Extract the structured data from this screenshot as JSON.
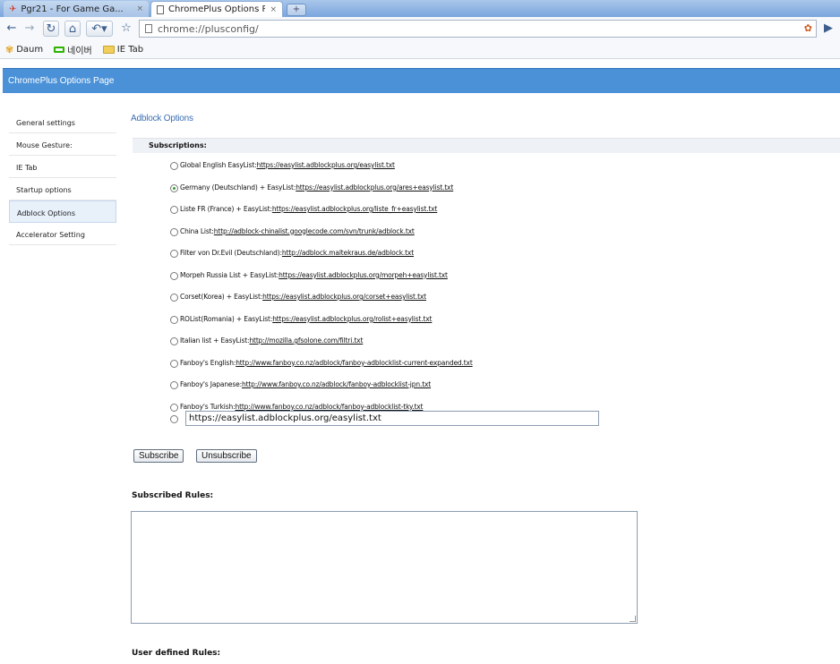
{
  "browser": {
    "tabs": [
      {
        "title": "Pgr21 - For Game Ga...",
        "active": false,
        "icon": "bird-favicon-icon"
      },
      {
        "title": "ChromePlus Options P...",
        "active": true,
        "icon": "page-favicon-icon"
      }
    ],
    "new_tab": "+",
    "tab_close": "×",
    "url": "chrome://plusconfig/",
    "bookmarks": [
      {
        "label": "Daum",
        "icon": "daum-icon"
      },
      {
        "label": "네이버",
        "icon": "naver-icon"
      },
      {
        "label": "IE Tab",
        "icon": "folder-icon"
      }
    ]
  },
  "header": {
    "title": "ChromePlus Options Page"
  },
  "sidebar": {
    "items": [
      {
        "label": "General settings",
        "selected": false
      },
      {
        "label": "Mouse Gesture:",
        "selected": false
      },
      {
        "label": "IE Tab",
        "selected": false
      },
      {
        "label": "Startup options",
        "selected": false
      },
      {
        "label": "Adblock Options",
        "selected": true
      },
      {
        "label": "Accelerator Setting",
        "selected": false
      }
    ]
  },
  "main": {
    "section_title": "Adblock Options",
    "subscriptions_label": "Subscriptions:",
    "subscriptions": [
      {
        "name": "Global English EasyList:",
        "url": "https://easylist.adblockplus.org/easylist.txt",
        "checked": false
      },
      {
        "name": "Germany (Deutschland) + EasyList:",
        "url": "https://easylist.adblockplus.org/ares+easylist.txt",
        "checked": true
      },
      {
        "name": "Liste FR (France) + EasyList:",
        "url": "https://easylist.adblockplus.org/liste_fr+easylist.txt",
        "checked": false
      },
      {
        "name": "China List:",
        "url": "http://adblock-chinalist.googlecode.com/svn/trunk/adblock.txt",
        "checked": false
      },
      {
        "name": "Filter von Dr.Evil (Deutschland):",
        "url": "http://adblock.maltekraus.de/adblock.txt",
        "checked": false
      },
      {
        "name": "Morpeh Russia List + EasyList:",
        "url": "https://easylist.adblockplus.org/morpeh+easylist.txt",
        "checked": false
      },
      {
        "name": "Corset(Korea) + EasyList: ",
        "url": "https://easylist.adblockplus.org/corset+easylist.txt",
        "checked": false
      },
      {
        "name": "ROList(Romania) + EasyList: ",
        "url": "https://easylist.adblockplus.org/rolist+easylist.txt",
        "checked": false
      },
      {
        "name": "Italian list + EasyList: ",
        "url": "http://mozilla.gfsolone.com/filtri.txt",
        "checked": false
      },
      {
        "name": "Fanboy's English: ",
        "url": "http://www.fanboy.co.nz/adblock/fanboy-adblocklist-current-expanded.txt",
        "checked": false
      },
      {
        "name": "Fanboy's Japanese: ",
        "url": "http://www.fanboy.co.nz/adblock/fanboy-adblocklist-jpn.txt",
        "checked": false
      },
      {
        "name": "Fanboy's Turkish: ",
        "url": "http://www.fanboy.co.nz/adblock/fanboy-adblocklist-tky.txt",
        "checked": false
      }
    ],
    "custom_url_value": "https://easylist.adblockplus.org/easylist.txt",
    "subscribe_label": "Subscribe",
    "unsubscribe_label": "Unsubscribe",
    "subscribed_rules_label": "Subscribed Rules:",
    "subscribed_rules_value": "",
    "user_rules_label": "User defined Rules:"
  },
  "colors": {
    "header": "#4a91d8",
    "section_title": "#3b6fb3",
    "tabstrip": "#7aa6dd"
  }
}
